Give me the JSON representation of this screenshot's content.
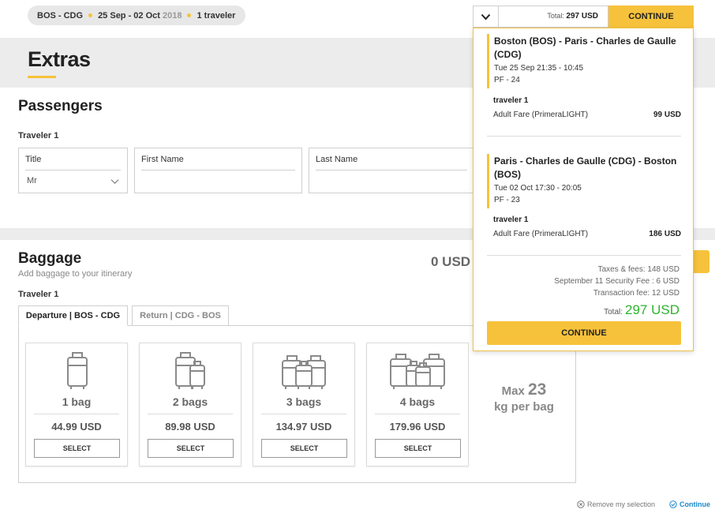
{
  "trip": {
    "route": "BOS - CDG",
    "dates": "25 Sep - 02 Oct",
    "year": "2018",
    "travelers": "1 traveler"
  },
  "page": {
    "title": "Extras"
  },
  "passengers": {
    "title": "Passengers",
    "traveler_label": "Traveler 1",
    "fields": {
      "title_label": "Title",
      "title_value": "Mr",
      "first_name_label": "First Name",
      "last_name_label": "Last Name"
    }
  },
  "baggage": {
    "title": "Baggage",
    "subtitle": "Add baggage to your itinerary",
    "total": "0 USD",
    "traveler_label": "Traveler 1",
    "tabs": [
      {
        "label": "Departure | BOS - CDG",
        "active": true
      },
      {
        "label": "Return | CDG - BOS",
        "active": false
      }
    ],
    "options": [
      {
        "count": "1 bag",
        "price": "44.99 USD",
        "select": "SELECT"
      },
      {
        "count": "2 bags",
        "price": "89.98 USD",
        "select": "SELECT"
      },
      {
        "count": "3 bags",
        "price": "134.97 USD",
        "select": "SELECT"
      },
      {
        "count": "4 bags",
        "price": "179.96 USD",
        "select": "SELECT"
      }
    ],
    "max_prefix": "Max",
    "max_value": "23",
    "max_suffix": "kg per bag"
  },
  "footer": {
    "remove": "Remove my selection",
    "continue": "Continue"
  },
  "summary": {
    "total_label": "Total:",
    "total_value": "297 USD",
    "continue_top": "CONTINUE",
    "legs": [
      {
        "title": "Boston (BOS) - Paris - Charles de Gaulle (CDG)",
        "time": "Tue 25 Sep 21:35 - 10:45",
        "flight": "PF - 24",
        "traveler": "traveler 1",
        "fare_label": "Adult Fare (PrimeraLIGHT)",
        "fare_price": "99 USD"
      },
      {
        "title": "Paris - Charles de Gaulle (CDG) - Boston (BOS)",
        "time": "Tue 02 Oct 17:30 - 20:05",
        "flight": "PF - 23",
        "traveler": "traveler 1",
        "fare_label": "Adult Fare (PrimeraLIGHT)",
        "fare_price": "186 USD"
      }
    ],
    "taxes": "Taxes & fees: 148 USD",
    "security_fee": "September 11 Security Fee : 6 USD",
    "transaction_fee": "Transaction fee: 12 USD",
    "grand_total_label": "Total:",
    "grand_total_value": "297 USD",
    "continue_bottom": "CONTINUE"
  },
  "colors": {
    "accent": "#f7c23b",
    "total_green": "#2db32d",
    "link_blue": "#1e88c9"
  }
}
